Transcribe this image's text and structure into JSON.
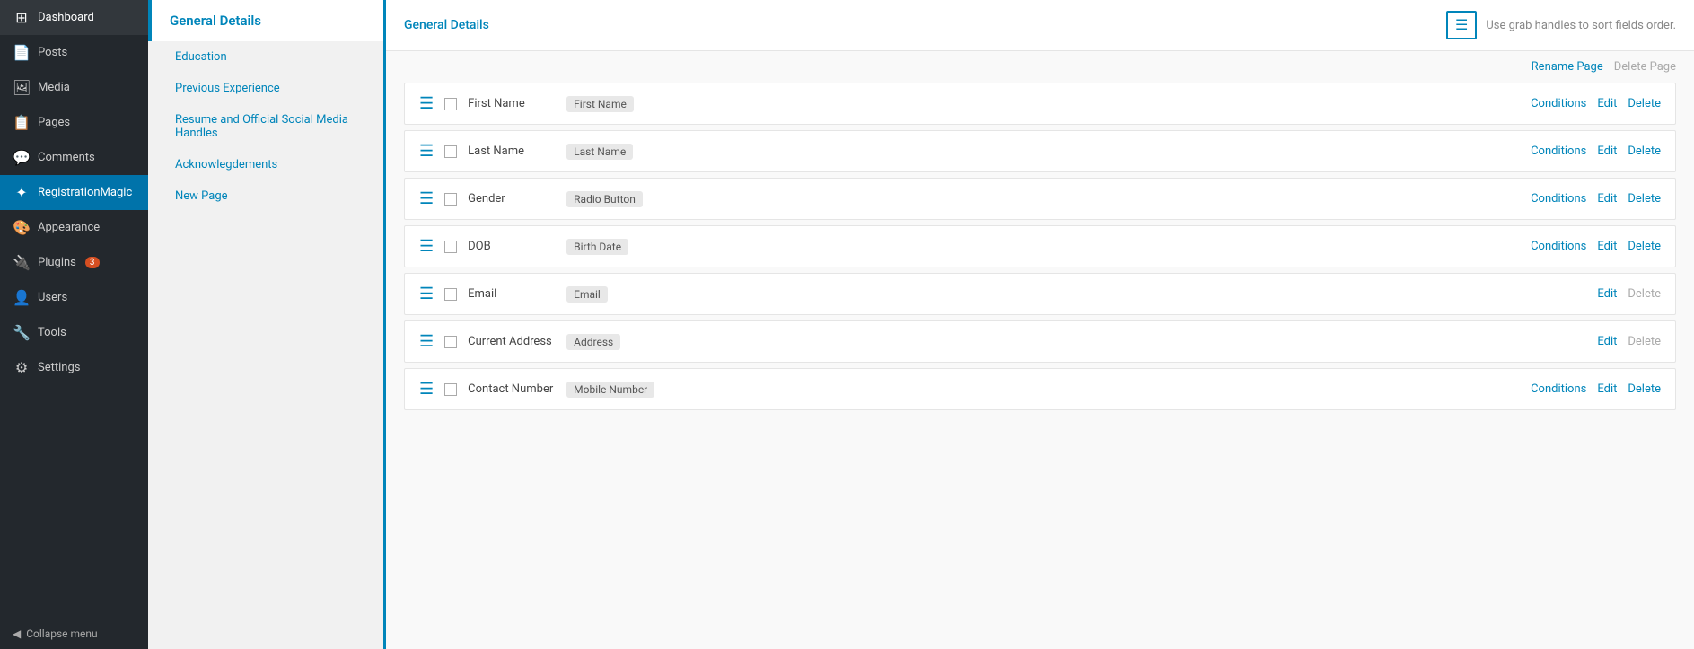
{
  "sidebar": {
    "items": [
      {
        "id": "dashboard",
        "label": "Dashboard",
        "icon": "⊞",
        "active": false
      },
      {
        "id": "posts",
        "label": "Posts",
        "icon": "📄",
        "active": false
      },
      {
        "id": "media",
        "label": "Media",
        "icon": "🖼",
        "active": false
      },
      {
        "id": "pages",
        "label": "Pages",
        "icon": "📋",
        "active": false
      },
      {
        "id": "comments",
        "label": "Comments",
        "icon": "💬",
        "active": false
      },
      {
        "id": "registrationmagic",
        "label": "RegistrationMagic",
        "icon": "✦",
        "active": true
      },
      {
        "id": "appearance",
        "label": "Appearance",
        "icon": "🎨",
        "active": false
      },
      {
        "id": "plugins",
        "label": "Plugins",
        "icon": "🔌",
        "active": false,
        "badge": "3"
      },
      {
        "id": "users",
        "label": "Users",
        "icon": "👤",
        "active": false
      },
      {
        "id": "tools",
        "label": "Tools",
        "icon": "🔧",
        "active": false
      },
      {
        "id": "settings",
        "label": "Settings",
        "icon": "⚙",
        "active": false
      }
    ],
    "collapse_label": "Collapse menu",
    "collapse_icon": "◀"
  },
  "left_panel": {
    "active_section": "General Details",
    "sections": [
      {
        "id": "education",
        "label": "Education"
      },
      {
        "id": "previous-experience",
        "label": "Previous Experience"
      },
      {
        "id": "resume",
        "label": "Resume and Official Social Media Handles"
      },
      {
        "id": "acknowlegdements",
        "label": "Acknowlegdements"
      },
      {
        "id": "new-page",
        "label": "New Page"
      }
    ]
  },
  "content": {
    "topbar": {
      "title": "General Details",
      "sort_hint": "Use grab handles to sort fields order.",
      "sort_icon": "☰"
    },
    "page_actions": {
      "rename_label": "Rename Page",
      "delete_label": "Delete Page"
    },
    "fields": [
      {
        "id": "first-name",
        "name": "First Name",
        "badge": "First Name",
        "has_conditions": true,
        "conditions_label": "Conditions",
        "edit_label": "Edit",
        "delete_label": "Delete"
      },
      {
        "id": "last-name",
        "name": "Last Name",
        "badge": "Last Name",
        "has_conditions": true,
        "conditions_label": "Conditions",
        "edit_label": "Edit",
        "delete_label": "Delete"
      },
      {
        "id": "gender",
        "name": "Gender",
        "badge": "Radio Button",
        "has_conditions": true,
        "conditions_label": "Conditions",
        "edit_label": "Edit",
        "delete_label": "Delete"
      },
      {
        "id": "dob",
        "name": "DOB",
        "badge": "Birth Date",
        "has_conditions": true,
        "conditions_label": "Conditions",
        "edit_label": "Edit",
        "delete_label": "Delete"
      },
      {
        "id": "email",
        "name": "Email",
        "badge": "Email",
        "has_conditions": false,
        "conditions_label": "",
        "edit_label": "Edit",
        "delete_label": "Delete"
      },
      {
        "id": "current-address",
        "name": "Current Address",
        "badge": "Address",
        "has_conditions": false,
        "conditions_label": "",
        "edit_label": "Edit",
        "delete_label": "Delete"
      },
      {
        "id": "contact-number",
        "name": "Contact Number",
        "badge": "Mobile Number",
        "has_conditions": true,
        "conditions_label": "Conditions",
        "edit_label": "Edit",
        "delete_label": "Delete"
      }
    ]
  }
}
